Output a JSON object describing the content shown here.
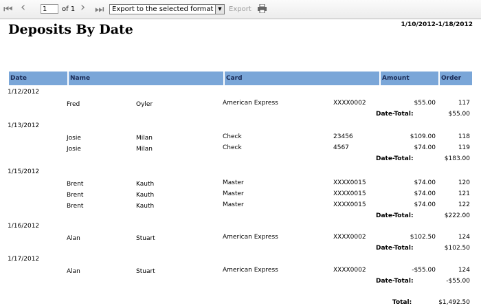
{
  "toolbar": {
    "page_value": "1",
    "page_of": "of 1",
    "export_format": "Export to the selected format",
    "export_label": "Export"
  },
  "report": {
    "title": "Deposits By Date",
    "date_range": "1/10/2012-1/18/2012",
    "columns": {
      "date": "Date",
      "name": "Name",
      "card": "Card",
      "amount": "Amount",
      "order": "Order"
    },
    "date_total_label": "Date-Total:",
    "total_label": "Total:",
    "grand_total": "$1,492.50",
    "groups": [
      {
        "date": "1/12/2012",
        "total": "$55.00",
        "rows": [
          {
            "first": "Fred",
            "last": "Oyler",
            "card": "American Express",
            "number": "XXXX0002",
            "amount": "$55.00",
            "order": "117"
          }
        ]
      },
      {
        "date": "1/13/2012",
        "total": "$183.00",
        "rows": [
          {
            "first": "Josie",
            "last": "Milan",
            "card": "Check",
            "number": "23456",
            "amount": "$109.00",
            "order": "118"
          },
          {
            "first": "Josie",
            "last": "Milan",
            "card": "Check",
            "number": "4567",
            "amount": "$74.00",
            "order": "119"
          }
        ]
      },
      {
        "date": "1/15/2012",
        "total": "$222.00",
        "rows": [
          {
            "first": "Brent",
            "last": "Kauth",
            "card": "Master",
            "number": "XXXX0015",
            "amount": "$74.00",
            "order": "120"
          },
          {
            "first": "Brent",
            "last": "Kauth",
            "card": "Master",
            "number": "XXXX0015",
            "amount": "$74.00",
            "order": "121"
          },
          {
            "first": "Brent",
            "last": "Kauth",
            "card": "Master",
            "number": "XXXX0015",
            "amount": "$74.00",
            "order": "122"
          }
        ]
      },
      {
        "date": "1/16/2012",
        "total": "$102.50",
        "rows": [
          {
            "first": "Alan",
            "last": "Stuart",
            "card": "American Express",
            "number": "XXXX0002",
            "amount": "$102.50",
            "order": "124"
          }
        ]
      },
      {
        "date": "1/17/2012",
        "total": "-$55.00",
        "rows": [
          {
            "first": "Alan",
            "last": "Stuart",
            "card": "American Express",
            "number": "XXXX0002",
            "amount": "-$55.00",
            "order": "124"
          }
        ]
      }
    ]
  }
}
